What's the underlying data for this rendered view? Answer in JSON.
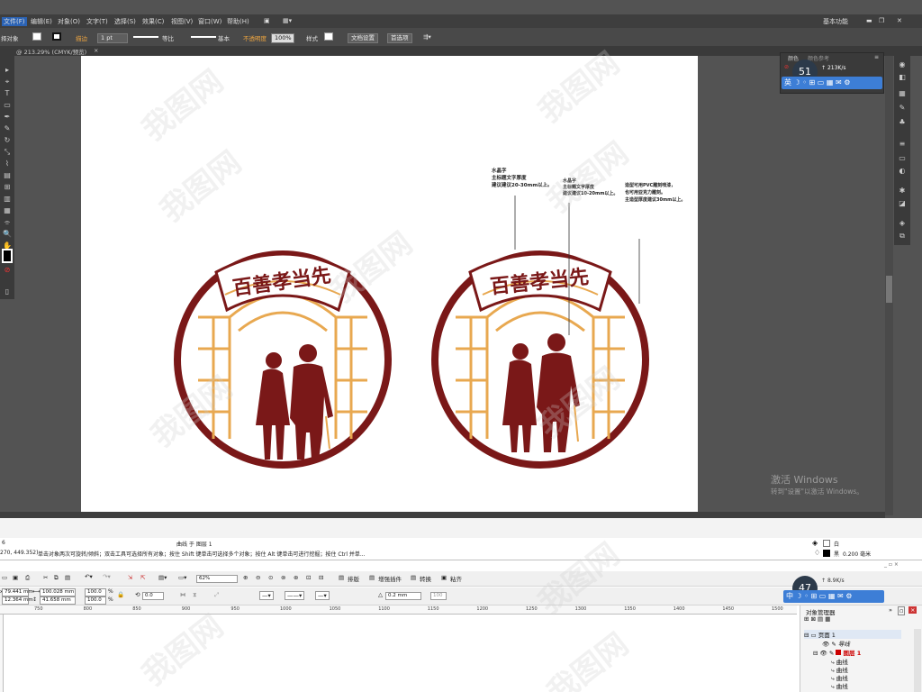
{
  "illustrator": {
    "menu": [
      "文件(F)",
      "编辑(E)",
      "对象(O)",
      "文字(T)",
      "选择(S)",
      "效果(C)",
      "视图(V)",
      "窗口(W)",
      "帮助(H)"
    ],
    "workspace": "基本功能",
    "control": {
      "selection_label": "择对象",
      "stroke_label": "描边",
      "stroke_weight": "1 pt",
      "profile_label": "等比",
      "brush_label": "基本",
      "opacity_label": "不透明度",
      "opacity_value": "100%",
      "style_label": "样式",
      "doc_setup_button": "文档设置",
      "prefs_button": "首选项"
    },
    "document_tab": "@ 213.29% (CMYK/预览)",
    "color_panel": {
      "tab_color": "颜色",
      "tab_guide": "颜色参考",
      "gauge_value": "51",
      "speed": "213",
      "speed_unit": "K/s"
    },
    "ime_letter": "英",
    "annotations": [
      {
        "title": "水晶字",
        "lines": [
          "主标题文字厚度",
          "建议建议20-30mm以上。"
        ]
      },
      {
        "title": "水晶字",
        "lines": [
          "主标题文字厚度",
          "建议建议10-20mm以上。"
        ]
      },
      {
        "title": "",
        "lines": [
          "造型可用PVC雕刻喷漆，",
          "也可用亚克力雕刻。",
          "主造型厚度建议30mm以上。"
        ]
      }
    ],
    "sign_text": "百善孝当先",
    "activation": {
      "title": "激活 Windows",
      "subtitle": "转到\"设置\"以激活 Windows。"
    },
    "watermark": "我图网"
  },
  "coreldraw": {
    "status": {
      "objects": "6",
      "object_info": "曲线 于 图层 1",
      "coords": "270, 449.352)",
      "hint": "单击对象两次可旋转/倾斜；双击工具可选择所有对象；按住 Shift 键单击可选择多个对象；按住 Alt 键单击可进行挖掘；按住 Ctrl 并单...",
      "fill_name": "白",
      "outline_name": "黑",
      "outline_width": "0.200 毫米"
    },
    "toolbar": {
      "zoom": "62%",
      "launch": "排版",
      "plugin": "增强插件",
      "convert": "转换",
      "paste": "粘齐"
    },
    "property_bar": {
      "x": "79.441 mm",
      "y": "12.364 mm",
      "w": "100.028 mm",
      "h": "41.658 mm",
      "scale_x": "100.0",
      "scale_y": "100.0",
      "percent": "%",
      "angle": "0.0",
      "outline": "0.2 mm",
      "opacity": "100"
    },
    "ruler_ticks": [
      "750",
      "800",
      "850",
      "900",
      "950",
      "1000",
      "1050",
      "1100",
      "1150",
      "1200",
      "1250",
      "1300",
      "1350",
      "1400",
      "1450",
      "1500"
    ],
    "object_manager": {
      "title": "对象管理器",
      "page": "页面 1",
      "guides": "导线",
      "layer": "图层 1",
      "items": [
        "曲线",
        "曲线",
        "曲线",
        "曲线"
      ]
    },
    "gauge_value": "47",
    "speed": "8.9",
    "speed_unit": "K/s",
    "ime_letter": "中"
  }
}
